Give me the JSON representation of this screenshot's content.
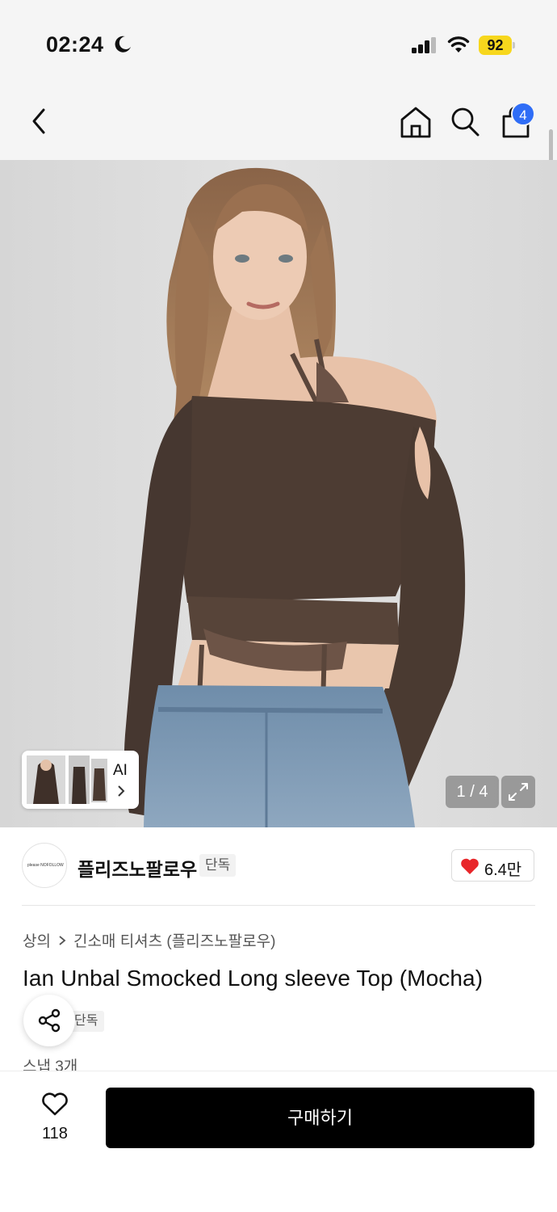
{
  "status_bar": {
    "time": "02:24",
    "battery": "92",
    "icons": [
      "moon-icon",
      "signal-icon",
      "wifi-icon",
      "battery-icon"
    ]
  },
  "nav": {
    "icons": [
      "back-icon",
      "home-icon",
      "search-icon",
      "cart-icon"
    ],
    "cart_badge": "4"
  },
  "gallery": {
    "ai_label": "AI",
    "page_counter": "1 / 4",
    "colors": {
      "background": "#dcdcdc",
      "garment": "#4d3c33"
    }
  },
  "brand": {
    "name": "플리즈노팔로우",
    "exclusive_badge": "단독",
    "logo_text": "please NOFOLLOW",
    "like_count": "6.4만"
  },
  "product": {
    "breadcrumb": [
      "상의",
      "긴소매 티셔츠 (플리즈노팔로우)"
    ],
    "title": "Ian Unbal Smocked Long sleeve Top (Mocha)",
    "tag": "단독",
    "snap_count": "스냅 3개"
  },
  "bottom_bar": {
    "wishlist_count": "118",
    "buy_label": "구매하기",
    "colors": {
      "buy_button": "#000000",
      "like_heart": "#e8262a",
      "cart_badge": "#2f6df6"
    }
  }
}
